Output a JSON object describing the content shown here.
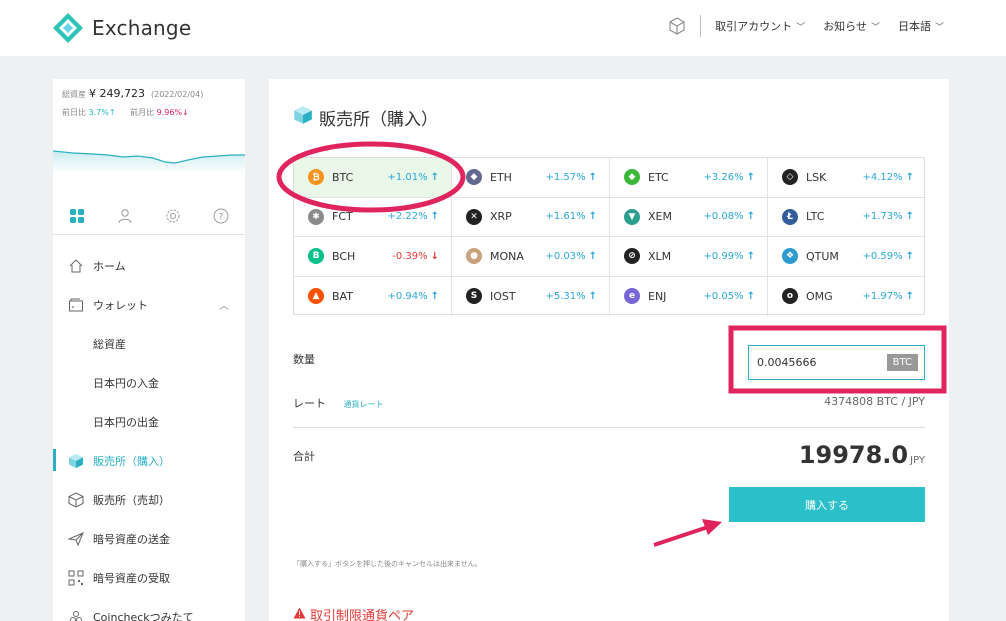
{
  "header": {
    "brand": "Exchange",
    "nav": [
      {
        "label": "取引アカウント"
      },
      {
        "label": "お知らせ"
      },
      {
        "label": "日本語"
      }
    ]
  },
  "sidebar": {
    "total_label": "総資産",
    "total_value": "¥ 249,723",
    "total_date": "(2022/02/04)",
    "day_label": "前日比",
    "day_value": "3.7%↑",
    "month_label": "前月比",
    "month_value": "9.96%↓",
    "menu": [
      {
        "label": "ホーム"
      },
      {
        "label": "ウォレット"
      },
      {
        "label": "総資産"
      },
      {
        "label": "日本円の入金"
      },
      {
        "label": "日本円の出金"
      },
      {
        "label": "販売所（購入）"
      },
      {
        "label": "販売所（売却）"
      },
      {
        "label": "暗号資産の送金"
      },
      {
        "label": "暗号資産の受取"
      },
      {
        "label": "Coincheckつみたて"
      }
    ]
  },
  "main": {
    "title": "販売所（購入）",
    "coins": [
      {
        "symbol": "BTC",
        "change": "+1.01%",
        "dir": "up",
        "color": "#f7931a",
        "glyph": "₿"
      },
      {
        "symbol": "ETH",
        "change": "+1.57%",
        "dir": "up",
        "color": "#62688f",
        "glyph": "◆"
      },
      {
        "symbol": "ETC",
        "change": "+3.26%",
        "dir": "up",
        "color": "#3ab83a",
        "glyph": "◆"
      },
      {
        "symbol": "LSK",
        "change": "+4.12%",
        "dir": "up",
        "color": "#222222",
        "glyph": "◇"
      },
      {
        "symbol": "FCT",
        "change": "+2.22%",
        "dir": "up",
        "color": "#8a8a8a",
        "glyph": "✱"
      },
      {
        "symbol": "XRP",
        "change": "+1.61%",
        "dir": "up",
        "color": "#222222",
        "glyph": "✕"
      },
      {
        "symbol": "XEM",
        "change": "+0.08%",
        "dir": "up",
        "color": "#2b9e8f",
        "glyph": "▼"
      },
      {
        "symbol": "LTC",
        "change": "+1.73%",
        "dir": "up",
        "color": "#345d9d",
        "glyph": "Ł"
      },
      {
        "symbol": "BCH",
        "change": "-0.39%",
        "dir": "down",
        "color": "#0ac18e",
        "glyph": "B"
      },
      {
        "symbol": "MONA",
        "change": "+0.03%",
        "dir": "up",
        "color": "#c8a27a",
        "glyph": "●"
      },
      {
        "symbol": "XLM",
        "change": "+0.99%",
        "dir": "up",
        "color": "#222222",
        "glyph": "⊘"
      },
      {
        "symbol": "QTUM",
        "change": "+0.59%",
        "dir": "up",
        "color": "#2e9ad0",
        "glyph": "❖"
      },
      {
        "symbol": "BAT",
        "change": "+0.94%",
        "dir": "up",
        "color": "#ff5000",
        "glyph": "▲"
      },
      {
        "symbol": "IOST",
        "change": "+5.31%",
        "dir": "up",
        "color": "#222222",
        "glyph": "S"
      },
      {
        "symbol": "ENJ",
        "change": "+0.05%",
        "dir": "up",
        "color": "#7866d5",
        "glyph": "e"
      },
      {
        "symbol": "OMG",
        "change": "+1.97%",
        "dir": "up",
        "color": "#222222",
        "glyph": "o"
      }
    ],
    "quantity_label": "数量",
    "quantity_value": "0.0045666",
    "quantity_unit": "BTC",
    "rate_label": "レート",
    "rate_link": "通貨レート",
    "rate_value": "4374808  BTC / JPY",
    "total_label": "合計",
    "total_amount": "19978.0",
    "total_unit": "JPY",
    "buy_button": "購入する",
    "note": "「購入する」ボタンを押した後のキャンセルは出来ません。",
    "restricted_title": "取引制限通貨ペア"
  },
  "colors": {
    "accent": "#2ab0c3",
    "annotation": "#e0245e",
    "selected_bg": "#e8f7e8"
  }
}
